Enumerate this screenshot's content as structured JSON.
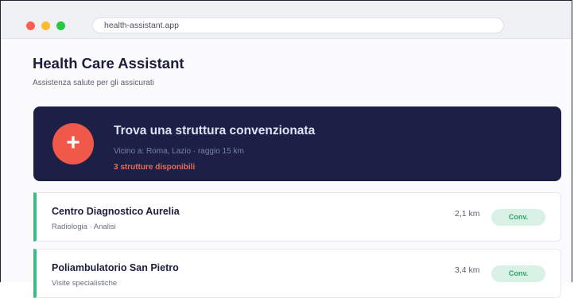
{
  "browser": {
    "url": "health-assistant.app"
  },
  "header": {
    "title": "Health Care Assistant",
    "subtitle": "Assistenza salute per gli assicurati"
  },
  "hero": {
    "icon": "plus-icon",
    "icon_glyph": "+",
    "title": "Trova una struttura convenzionata",
    "location": "Vicino a: Roma, Lazio · raggio 15 km",
    "count": "3 strutture disponibili"
  },
  "facilities": [
    {
      "name": "Centro Diagnostico Aurelia",
      "services": "Radiologia · Analisi",
      "distance": "2,1 km",
      "badge": "Conv."
    },
    {
      "name": "Poliambulatorio San Pietro",
      "services": "Visite specialistiche",
      "distance": "3,4 km",
      "badge": "Conv."
    }
  ],
  "colors": {
    "hero_bg": "#1c2046",
    "accent_red": "#f0584a",
    "accent_green": "#3dbb84",
    "badge_bg": "#d8f1e4"
  }
}
